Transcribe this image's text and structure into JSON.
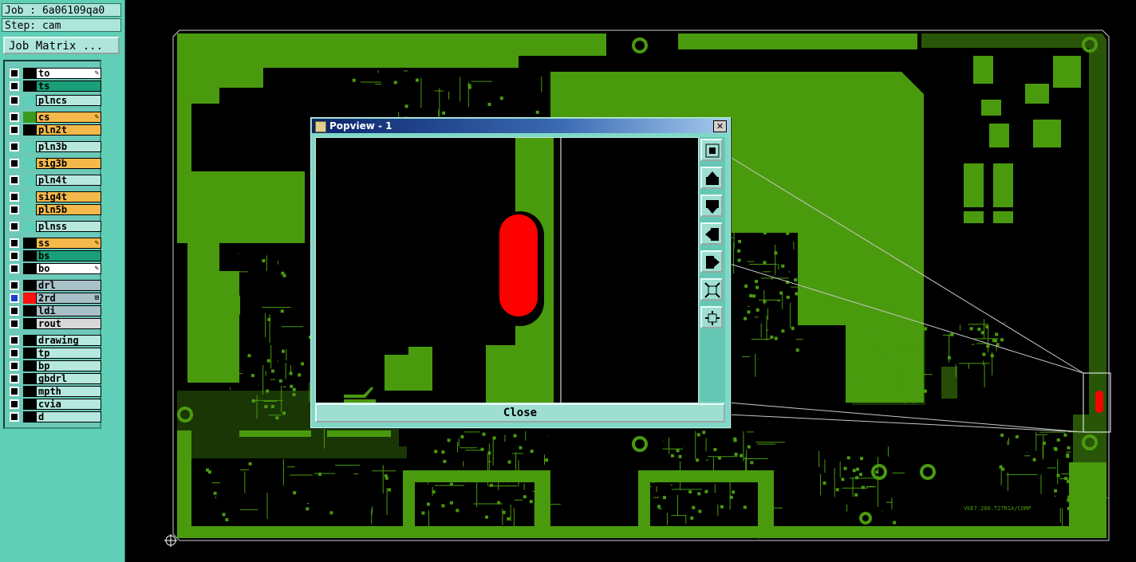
{
  "job": {
    "job_label": "Job : 6a06109qa0",
    "step_label": "Step: cam",
    "matrix_button": "Job Matrix ..."
  },
  "layers": [
    {
      "name": "to",
      "color": "#ffffff",
      "swatch": "#000000",
      "marker": "✎",
      "checked": false
    },
    {
      "name": "ts",
      "color": "#1aa078",
      "swatch": "#000000",
      "marker": "",
      "checked": false
    },
    {
      "name": "plncs",
      "color": "#b6e8de",
      "swatch": "#5fcfb6",
      "marker": "",
      "checked": false
    },
    {
      "name": "cs",
      "color": "#f5b84a",
      "swatch": "#3a9a1c",
      "marker": "✎",
      "checked": false
    },
    {
      "name": "pln2t",
      "color": "#f5b84a",
      "swatch": "#000000",
      "marker": "",
      "checked": false
    },
    {
      "name": "pln3b",
      "color": "#b6e8de",
      "swatch": "#5fcfb6",
      "marker": "",
      "checked": false
    },
    {
      "name": "sig3b",
      "color": "#f5b84a",
      "swatch": "#5fcfb6",
      "marker": "",
      "checked": false
    },
    {
      "name": "pln4t",
      "color": "#b6e8de",
      "swatch": "#5fcfb6",
      "marker": "",
      "checked": false
    },
    {
      "name": "sig4t",
      "color": "#f5b84a",
      "swatch": "#5fcfb6",
      "marker": "",
      "checked": false
    },
    {
      "name": "pln5b",
      "color": "#f5b84a",
      "swatch": "#5fcfb6",
      "marker": "",
      "checked": false
    },
    {
      "name": "plnss",
      "color": "#b6e8de",
      "swatch": "#5fcfb6",
      "marker": "",
      "checked": false
    },
    {
      "name": "ss",
      "color": "#f5b84a",
      "swatch": "#000000",
      "marker": "✎",
      "checked": false
    },
    {
      "name": "bs",
      "color": "#1aa078",
      "swatch": "#000000",
      "marker": "",
      "checked": false
    },
    {
      "name": "bo",
      "color": "#ffffff",
      "swatch": "#000000",
      "marker": "✎",
      "checked": false
    },
    {
      "name": "drl",
      "color": "#a8c0c8",
      "swatch": "#000000",
      "marker": "",
      "checked": false
    },
    {
      "name": "2rd",
      "color": "#a8c0c8",
      "swatch": "#ff1010",
      "marker": "⊞",
      "checked": true
    },
    {
      "name": "ldi",
      "color": "#a8c0c8",
      "swatch": "#000000",
      "marker": "",
      "checked": false
    },
    {
      "name": "rout",
      "color": "#d8d8d8",
      "swatch": "#000000",
      "marker": "",
      "checked": false
    },
    {
      "name": "drawing",
      "color": "#b6e8de",
      "swatch": "#000000",
      "marker": "",
      "checked": false
    },
    {
      "name": "tp",
      "color": "#b6e8de",
      "swatch": "#000000",
      "marker": "",
      "checked": false
    },
    {
      "name": "bp",
      "color": "#b6e8de",
      "swatch": "#000000",
      "marker": "",
      "checked": false
    },
    {
      "name": "gbdrl",
      "color": "#b6e8de",
      "swatch": "#000000",
      "marker": "",
      "checked": false
    },
    {
      "name": "mpth",
      "color": "#b6e8de",
      "swatch": "#000000",
      "marker": "",
      "checked": false
    },
    {
      "name": "cvia",
      "color": "#b6e8de",
      "swatch": "#000000",
      "marker": "",
      "checked": false
    },
    {
      "name": "d",
      "color": "#b6e8de",
      "swatch": "#000000",
      "marker": "",
      "checked": false
    }
  ],
  "popview": {
    "title": "Popview - 1",
    "close_button": "Close",
    "tools": [
      "zoom-fit-icon",
      "pan-up-icon",
      "pan-down-icon",
      "pan-left-icon",
      "pan-right-icon",
      "zoom-out-icon",
      "zoom-in-icon"
    ]
  },
  "board": {
    "silkscreen_text": "VKE7.200.T27R1A/COMP",
    "copper_color": "#4a9a0e",
    "drill_color": "#ff0000"
  }
}
